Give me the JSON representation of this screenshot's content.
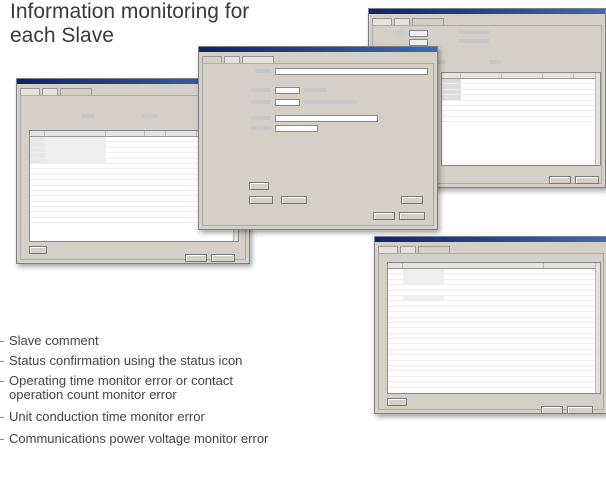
{
  "heading": {
    "line1": "Information monitoring for",
    "line2": "each Slave"
  },
  "legend": [
    "Slave comment",
    "Status confirmation using the status icon",
    "Operating time monitor error or contact",
    "operation count monitor error",
    "Unit conduction time monitor error",
    "Communications power voltage monitor error"
  ]
}
